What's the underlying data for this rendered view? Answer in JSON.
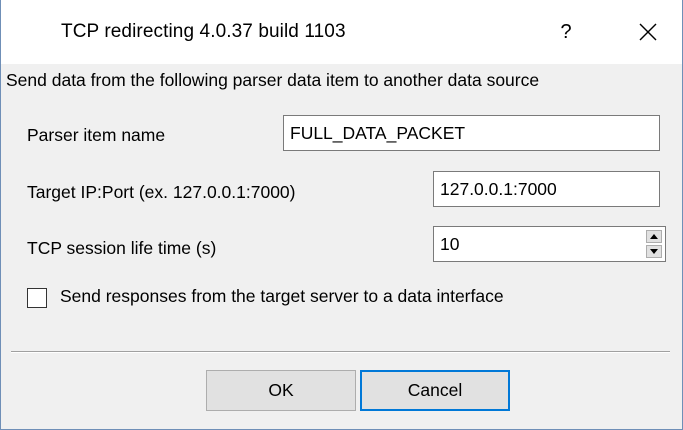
{
  "window": {
    "title": "TCP redirecting 4.0.37 build 1103",
    "help_label": "?",
    "close_icon": "close-icon"
  },
  "form": {
    "description": "Send data from the following parser data item to another data source",
    "parser_item_label": "Parser item name",
    "parser_item_value": "FULL_DATA_PACKET",
    "target_label": "Target IP:Port (ex. 127.0.0.1:7000)",
    "target_value": "127.0.0.1:7000",
    "session_label": "TCP session life time (s)",
    "session_value": "10",
    "checkbox_label": "Send responses from the target server to a data interface",
    "checkbox_checked": false
  },
  "buttons": {
    "ok_label": "OK",
    "cancel_label": "Cancel"
  },
  "colors": {
    "accent": "#0078d7",
    "dialog_bg": "#f0f0f0",
    "window_border": "#6f8fb7"
  }
}
